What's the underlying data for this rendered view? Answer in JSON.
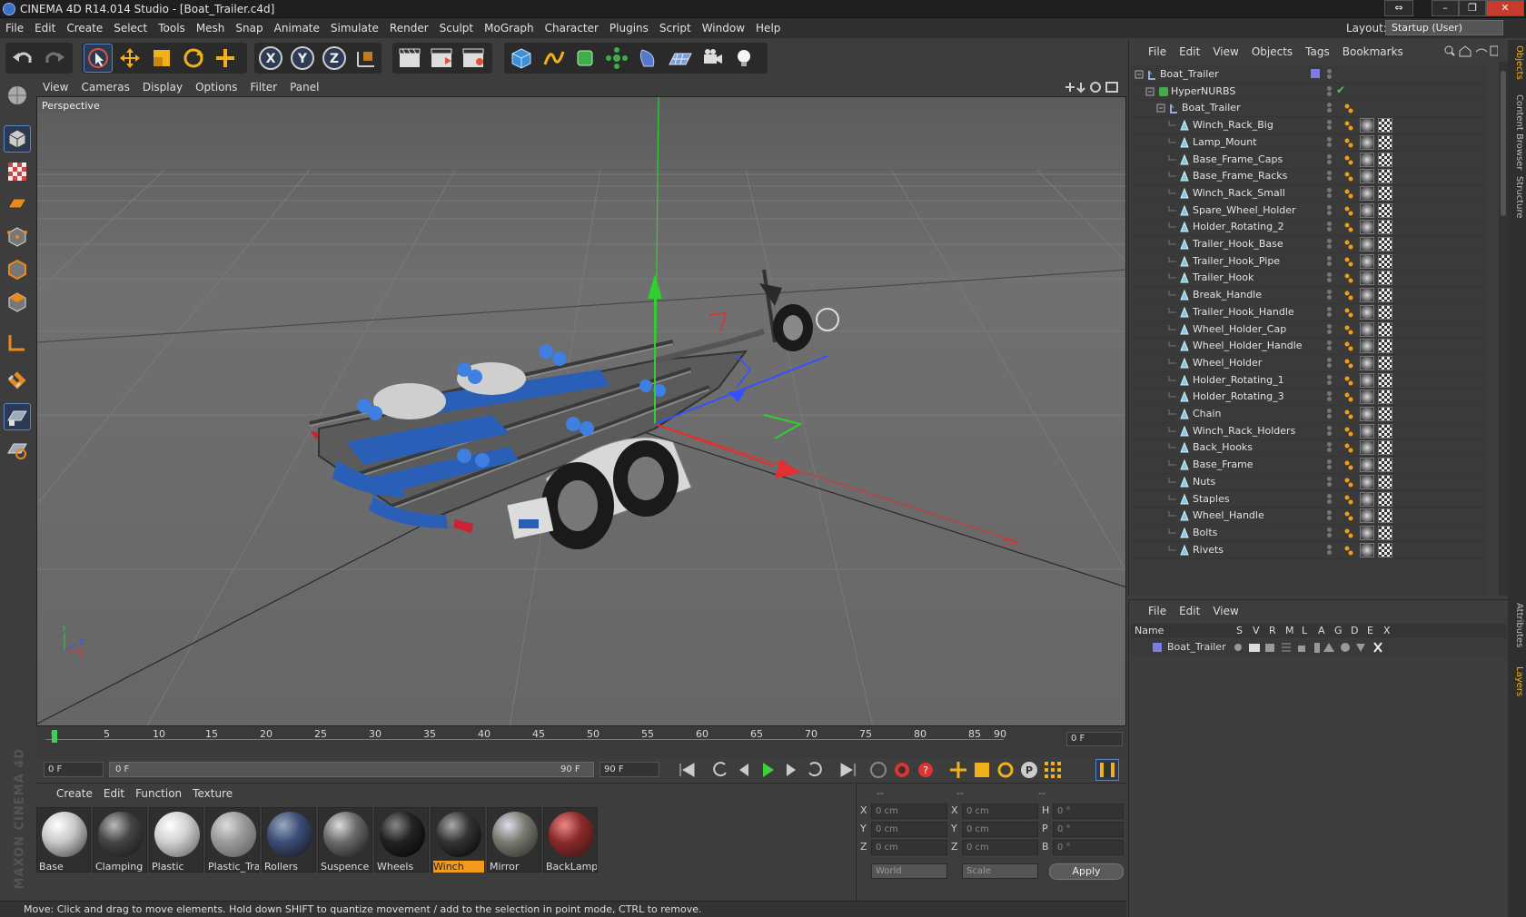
{
  "window": {
    "title": "CINEMA 4D R14.014 Studio - [Boat_Trailer.c4d]",
    "controls": [
      "⇔",
      "–",
      "❐",
      "✕"
    ]
  },
  "menubar": {
    "items": [
      "File",
      "Edit",
      "Create",
      "Select",
      "Tools",
      "Mesh",
      "Snap",
      "Animate",
      "Simulate",
      "Render",
      "Sculpt",
      "MoGraph",
      "Character",
      "Plugins",
      "Script",
      "Window",
      "Help"
    ]
  },
  "layout": {
    "label": "Layout:",
    "value": "Startup (User)"
  },
  "viewport": {
    "menu": [
      "View",
      "Cameras",
      "Display",
      "Options",
      "Filter",
      "Panel"
    ],
    "camera_label": "Perspective",
    "axis_labels": {
      "x": "X",
      "y": "Y",
      "z": "Z"
    }
  },
  "timeline": {
    "ticks": [
      "0",
      "5",
      "10",
      "15",
      "20",
      "25",
      "30",
      "35",
      "40",
      "45",
      "50",
      "55",
      "60",
      "65",
      "70",
      "75",
      "80",
      "85",
      "90"
    ],
    "current_frame": "0 F",
    "start_field": "0 F",
    "range_start": "0 F",
    "range_end": "90 F",
    "end_field": "90 F"
  },
  "materials": {
    "menu": [
      "Create",
      "Edit",
      "Function",
      "Texture"
    ],
    "items": [
      {
        "name": "Base",
        "color": "#c8c8c8"
      },
      {
        "name": "Clamping",
        "color": "#444444"
      },
      {
        "name": "Plastic",
        "color": "#d0d0d0"
      },
      {
        "name": "Plastic_Trar",
        "color": "#9a9a9a"
      },
      {
        "name": "Rollers",
        "color": "#3b4d78"
      },
      {
        "name": "Suspence",
        "color": "#6a6a6a"
      },
      {
        "name": "Wheels",
        "color": "#222222"
      },
      {
        "name": "Winch",
        "color": "#333333"
      },
      {
        "name": "Mirror",
        "color": "#7a7a70"
      },
      {
        "name": "BackLamps",
        "color": "#8a2a2a"
      }
    ],
    "active": "Winch"
  },
  "coordinates": {
    "headers": [
      "--",
      "--",
      "--"
    ],
    "rows": [
      {
        "a_label": "X",
        "a_value": "0 cm",
        "b_label": "X",
        "b_value": "0 cm",
        "c_label": "H",
        "c_value": "0 °"
      },
      {
        "a_label": "Y",
        "a_value": "0 cm",
        "b_label": "Y",
        "b_value": "0 cm",
        "c_label": "P",
        "c_value": "0 °"
      },
      {
        "a_label": "Z",
        "a_value": "0 cm",
        "b_label": "Z",
        "b_value": "0 cm",
        "c_label": "B",
        "c_value": "0 °"
      }
    ],
    "space": "World",
    "mode": "Scale",
    "apply": "Apply"
  },
  "status": "Move: Click and drag to move elements. Hold down SHIFT to quantize movement / add to the selection in point mode, CTRL to remove.",
  "objects": {
    "menu": [
      "File",
      "Edit",
      "View",
      "Objects",
      "Tags",
      "Bookmarks"
    ],
    "root": "Boat_Trailer",
    "hypernurbs": "HyperNURBS",
    "group": "Boat_Trailer",
    "children": [
      "Winch_Rack_Big",
      "Lamp_Mount",
      "Base_Frame_Caps",
      "Base_Frame_Racks",
      "Winch_Rack_Small",
      "Spare_Wheel_Holder",
      "Holder_Rotating_2",
      "Trailer_Hook_Base",
      "Trailer_Hook_Pipe",
      "Trailer_Hook",
      "Break_Handle",
      "Trailer_Hook_Handle",
      "Wheel_Holder_Cap",
      "Wheel_Holder_Handle",
      "Wheel_Holder",
      "Holder_Rotating_1",
      "Holder_Rotating_3",
      "Chain",
      "Winch_Rack_Holders",
      "Back_Hooks",
      "Base_Frame",
      "Nuts",
      "Staples",
      "Wheel_Handle",
      "Bolts",
      "Rivets"
    ]
  },
  "layers": {
    "menu": [
      "File",
      "Edit",
      "View"
    ],
    "columns": {
      "name": "Name",
      "flags": [
        "S",
        "V",
        "R",
        "M",
        "L",
        "A",
        "G",
        "D",
        "E",
        "X"
      ]
    },
    "rows": [
      {
        "name": "Boat_Trailer",
        "color": "#7b7be0"
      }
    ]
  },
  "side_tabs": [
    "Objects",
    "Content Browser",
    "Structure",
    "Attributes",
    "Layers"
  ],
  "brand": "MAXON CINEMA 4D"
}
